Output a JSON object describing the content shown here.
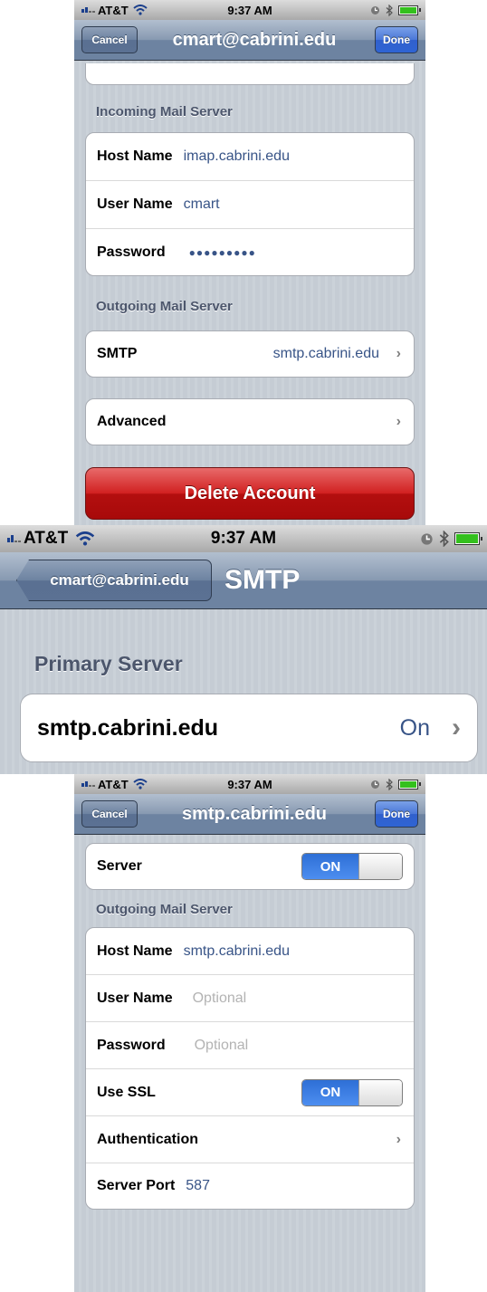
{
  "status": {
    "carrier": "AT&T",
    "time": "9:37 AM"
  },
  "screen1": {
    "cancel": "Cancel",
    "title": "cmart@cabrini.edu",
    "done": "Done",
    "incoming_header": "Incoming Mail Server",
    "host_label": "Host Name",
    "host_value": "imap.cabrini.edu",
    "user_label": "User Name",
    "user_value": "cmart",
    "pass_label": "Password",
    "pass_value": "●●●●●●●●●",
    "outgoing_header": "Outgoing Mail Server",
    "smtp_label": "SMTP",
    "smtp_value": "smtp.cabrini.edu",
    "advanced_label": "Advanced",
    "delete_label": "Delete Account"
  },
  "screen2": {
    "back": "cmart@cabrini.edu",
    "title": "SMTP",
    "primary_header": "Primary Server",
    "server_label": "smtp.cabrini.edu",
    "server_status": "On"
  },
  "screen3": {
    "cancel": "Cancel",
    "title": "smtp.cabrini.edu",
    "done": "Done",
    "server_label": "Server",
    "server_toggle": "ON",
    "outgoing_header": "Outgoing Mail Server",
    "host_label": "Host Name",
    "host_value": "smtp.cabrini.edu",
    "user_label": "User Name",
    "user_placeholder": "Optional",
    "pass_label": "Password",
    "pass_placeholder": "Optional",
    "ssl_label": "Use SSL",
    "ssl_toggle": "ON",
    "auth_label": "Authentication",
    "port_label": "Server Port",
    "port_value": "587"
  },
  "icons": [
    "signal-bars-icon",
    "wifi-icon",
    "clock-icon",
    "bluetooth-icon",
    "battery-icon",
    "chevron-right-icon"
  ],
  "colors": {
    "navbar": "#6d83a1",
    "done_button": "#2f64d4",
    "delete_button": "#c41616",
    "toggle_on": "#2e6fd6",
    "value_text": "#385487"
  }
}
